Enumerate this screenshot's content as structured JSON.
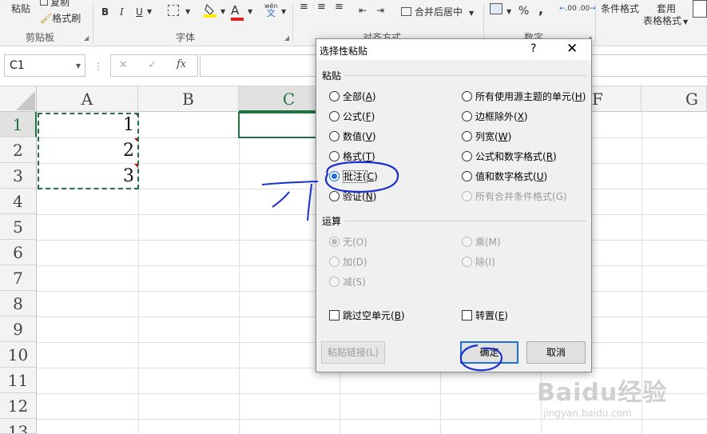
{
  "ribbon": {
    "paste_label": "粘贴",
    "copy_label": "复制",
    "format_painter_label": "格式刷",
    "clipboard_group": "剪贴板",
    "font_group": "字体",
    "bold": "B",
    "italic": "I",
    "underline": "U",
    "font_color_glyph": "A",
    "phonetic_glyph": "wén",
    "phonetic_glyph2": "文",
    "alignment_group": "对齐方式",
    "merge_center_label": "合并后居中",
    "number_group": "数字",
    "percent": "%",
    "comma": ",",
    "inc_decimal": ".00",
    "dec_decimal": ".00",
    "conditional_format": "条件格式",
    "table_format_1": "套用",
    "table_format_2": "表格格式"
  },
  "formula_bar": {
    "name_box": "C1",
    "fx": "fx",
    "cancel": "✕",
    "enter": "✓"
  },
  "sheet": {
    "columns": [
      "A",
      "B",
      "C",
      "F",
      "G"
    ],
    "rows": [
      "1",
      "2",
      "3",
      "4",
      "5",
      "6",
      "7",
      "8",
      "9",
      "10",
      "11",
      "12",
      "13"
    ],
    "cells": [
      "1",
      "2",
      "3"
    ]
  },
  "dialog": {
    "title": "选择性粘贴",
    "help": "?",
    "close": "✕",
    "paste_section": "粘贴",
    "paste_options_left": [
      {
        "label": "全部(",
        "key": "A",
        "end": ")",
        "checked": false
      },
      {
        "label": "公式(",
        "key": "F",
        "end": ")",
        "checked": false
      },
      {
        "label": "数值(",
        "key": "V",
        "end": ")",
        "checked": false
      },
      {
        "label": "格式(",
        "key": "T",
        "end": ")",
        "checked": false
      },
      {
        "label": "批注(",
        "key": "C",
        "end": ")",
        "checked": true
      },
      {
        "label": "验证(",
        "key": "N",
        "end": ")",
        "checked": false
      }
    ],
    "paste_options_right": [
      {
        "label": "所有使用源主题的单元(",
        "key": "H",
        "end": ")",
        "disabled": false
      },
      {
        "label": "边框除外(",
        "key": "X",
        "end": ")",
        "disabled": false
      },
      {
        "label": "列宽(",
        "key": "W",
        "end": ")",
        "disabled": false
      },
      {
        "label": "公式和数字格式(",
        "key": "R",
        "end": ")",
        "disabled": false
      },
      {
        "label": "值和数字格式(",
        "key": "U",
        "end": ")",
        "disabled": false
      },
      {
        "label": "所有合并条件格式(",
        "key": "G",
        "end": ")",
        "disabled": true
      }
    ],
    "operation_section": "运算",
    "operation_left": [
      {
        "label": "无(O)",
        "checked": true
      },
      {
        "label": "加(D)",
        "checked": false
      },
      {
        "label": "减(S)",
        "checked": false
      }
    ],
    "operation_right": [
      {
        "label": "乘(M)"
      },
      {
        "label": "除(I)"
      }
    ],
    "skip_blanks": "跳过空单元(",
    "skip_blanks_key": "B",
    "transpose": "转置(",
    "transpose_key": "E",
    "close_paren": ")",
    "paste_link": "粘贴链接(L)",
    "ok": "确定",
    "cancel": "取消"
  },
  "watermark": {
    "brand": "Baidu经验",
    "url": "jingyan.baidu.com"
  },
  "colors": {
    "excel_green": "#217346",
    "accent_blue": "#1e6fd9",
    "ink_blue": "#1a2fd0"
  }
}
